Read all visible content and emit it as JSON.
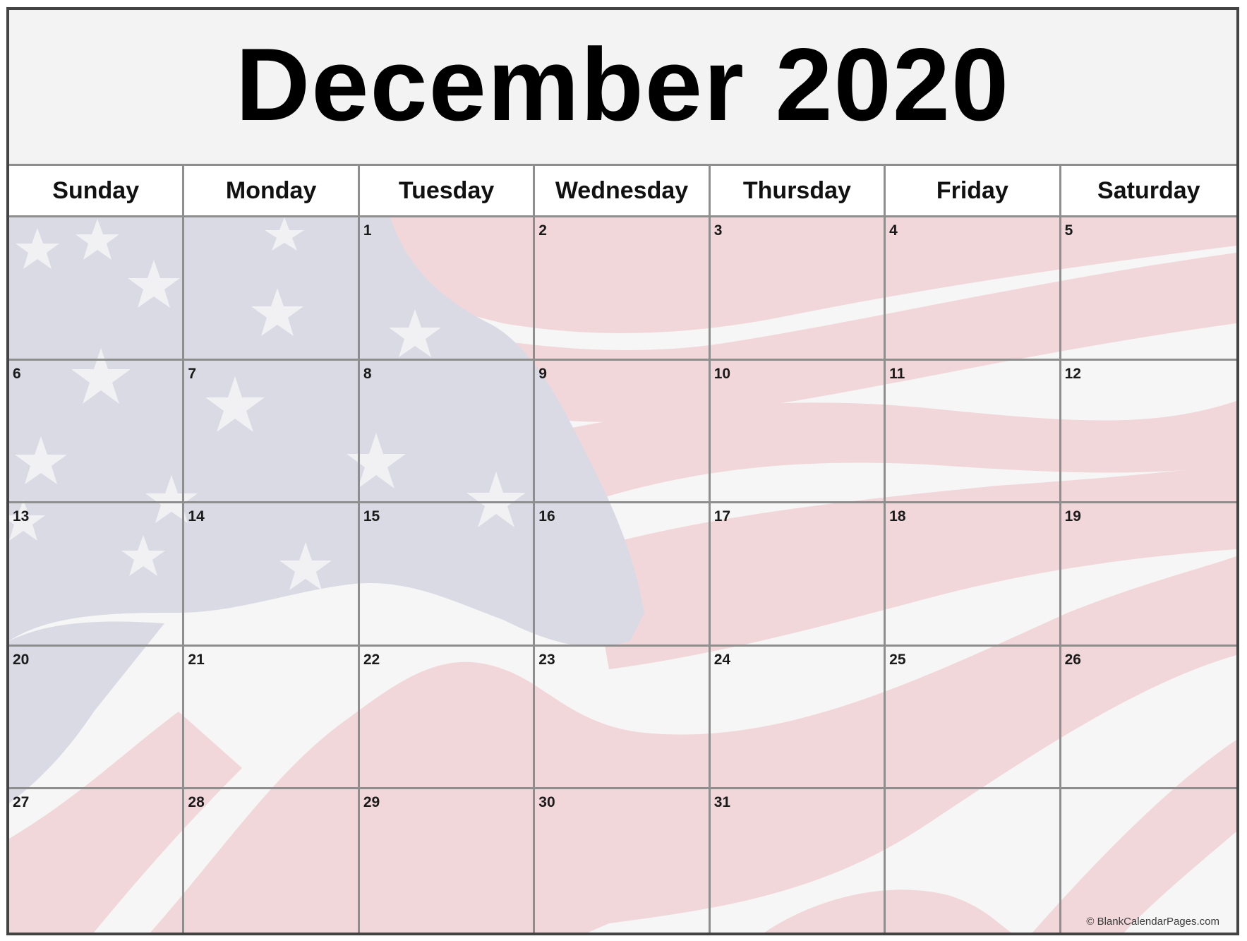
{
  "calendar": {
    "title": "December 2020",
    "month": "December",
    "year": 2020,
    "weekdays": [
      "Sunday",
      "Monday",
      "Tuesday",
      "Wednesday",
      "Thursday",
      "Friday",
      "Saturday"
    ],
    "weeks": [
      [
        "",
        "",
        "1",
        "2",
        "3",
        "4",
        "5"
      ],
      [
        "6",
        "7",
        "8",
        "9",
        "10",
        "11",
        "12"
      ],
      [
        "13",
        "14",
        "15",
        "16",
        "17",
        "18",
        "19"
      ],
      [
        "20",
        "21",
        "22",
        "23",
        "24",
        "25",
        "26"
      ],
      [
        "27",
        "28",
        "29",
        "30",
        "31",
        "",
        ""
      ]
    ],
    "background_theme": "american-flag",
    "copyright": "© BlankCalendarPages.com"
  },
  "colors": {
    "frame_border": "#434343",
    "grid_line": "#8e8e8e",
    "title_bg": "#f3f3f3",
    "header_bg": "#ffffff",
    "flag_blue_tint": "#d9dae4",
    "flag_red_tint": "#f1d7d9",
    "flag_white": "#f6f6f6",
    "text": "#111111"
  }
}
